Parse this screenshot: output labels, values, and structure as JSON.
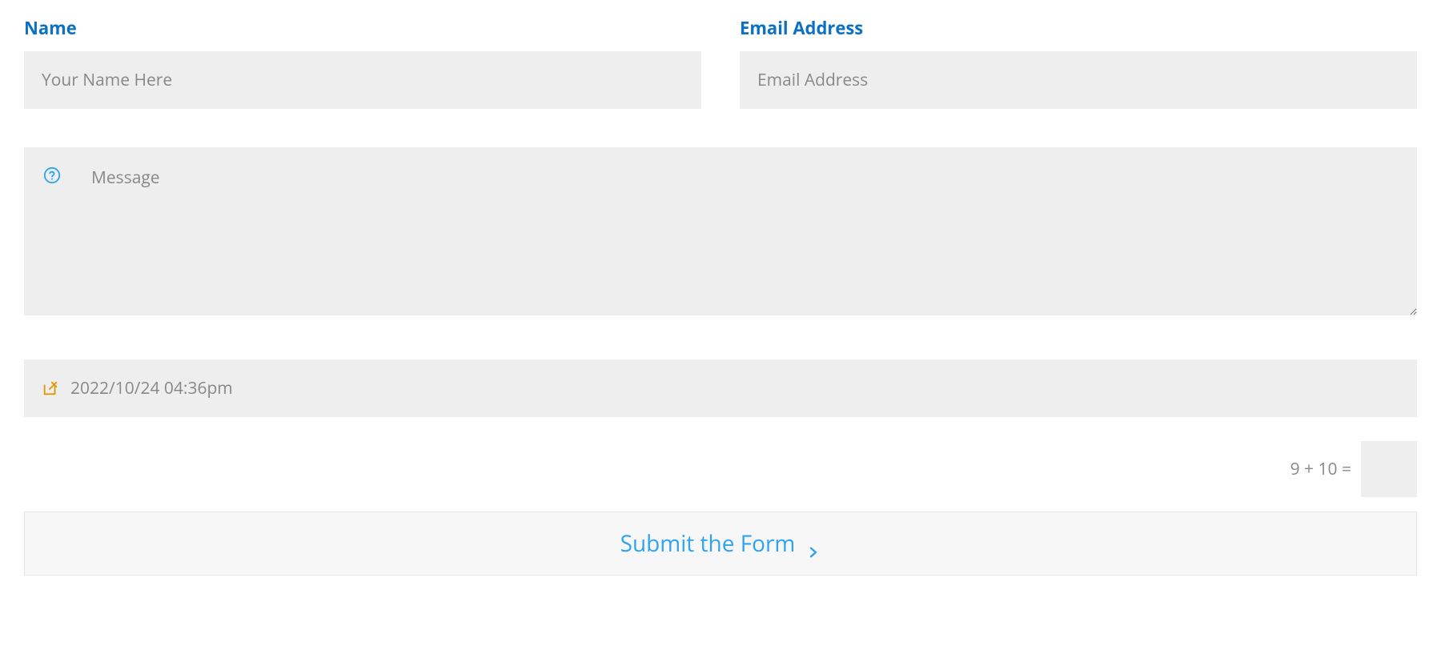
{
  "form": {
    "name": {
      "label": "Name",
      "placeholder": "Your Name Here",
      "value": ""
    },
    "email": {
      "label": "Email Address",
      "placeholder": "Email Address",
      "value": ""
    },
    "message": {
      "placeholder": "Message",
      "value": "",
      "icon": "question-circle-icon"
    },
    "datetime": {
      "value": "2022/10/24 04:36pm",
      "icon": "pencil-square-icon"
    },
    "captcha": {
      "question": "9 + 10 =",
      "value": ""
    },
    "submit": {
      "label": "Submit the Form"
    }
  },
  "colors": {
    "accent": "#0c71c3",
    "link": "#2ea3f2",
    "icon_orange": "#e09900",
    "field_bg": "#eeeeee",
    "placeholder": "#888888"
  }
}
